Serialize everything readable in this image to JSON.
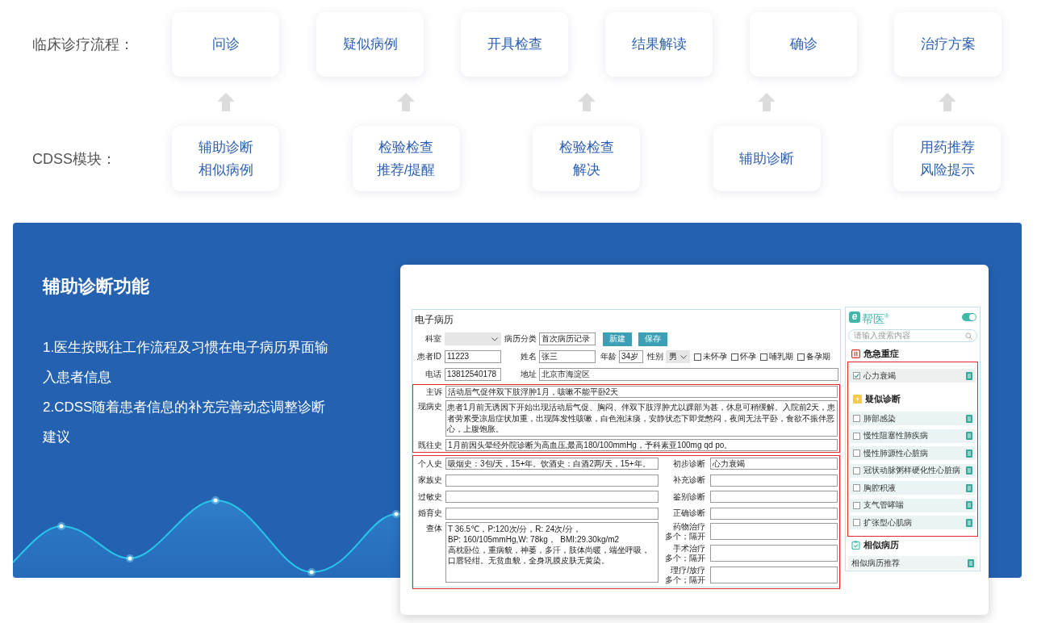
{
  "flow": {
    "label": "临床诊疗流程：",
    "steps": [
      "问诊",
      "疑似病例",
      "开具检查",
      "结果解读",
      "确诊",
      "治疗方案"
    ]
  },
  "cdss": {
    "label": "CDSS模块：",
    "modules": [
      "辅助诊断相似病例",
      "检验检查推荐/提醒",
      "检验检查解决",
      "辅助诊断",
      "用药推荐风险提示"
    ]
  },
  "feature": {
    "title": "辅助诊断功能",
    "points": [
      "1.医生按既往工作流程及习惯在电子病历界面输入患者信息",
      "2.CDSS随着患者信息的补充完善动态调整诊断建议"
    ]
  },
  "emr": {
    "title": "电子病历",
    "department": {
      "label": "科室"
    },
    "record_type": {
      "label": "病历分类",
      "value": "首次病历记录"
    },
    "buttons": [
      "新建",
      "保存"
    ],
    "patient_id": {
      "label": "患者ID",
      "value": "11223"
    },
    "name": {
      "label": "姓名",
      "value": "张三"
    },
    "age": {
      "label": "年龄",
      "value": "34岁"
    },
    "sex": {
      "label": "性别",
      "value": "男"
    },
    "pregnancy": [
      {
        "label": "未怀孕",
        "checked": false
      },
      {
        "label": "怀孕",
        "checked": false
      },
      {
        "label": "哺乳期",
        "checked": false
      },
      {
        "label": "备孕期",
        "checked": false
      }
    ],
    "phone": {
      "label": "电话",
      "value": "13812540178"
    },
    "address": {
      "label": "地址",
      "value": "北京市海淀区"
    },
    "history": [
      {
        "kind": "line",
        "label": "主诉",
        "value": "活动后气促伴双下肢浮肿1月，咳嗽不能平卧2天"
      },
      {
        "kind": "area",
        "label": "现病史",
        "value": "患者1月前无诱因下开始出现活动后气促、胸闷、伴双下肢浮肿尤以踝部为甚，休息可稍缓解。入院前2天，患者劳累受凉后症状加重，出现阵发性咳嗽，白色泡沫痰，安静状态下即觉憋闷，夜间无法平卧，食欲不振伴恶心，上腹饱胀。"
      },
      {
        "kind": "line",
        "label": "既往史",
        "value": "1月前因头晕经外院诊断为高血压,最高180/100mmHg，予科素亚100mg qd po。"
      }
    ],
    "details_left": [
      {
        "kind": "line",
        "label": "个人史",
        "value": "吸烟史：3包/天，15+年。饮酒史：白酒2两/天，15+年。"
      },
      {
        "kind": "line",
        "label": "家族史"
      },
      {
        "kind": "line",
        "label": "过敏史"
      },
      {
        "kind": "line",
        "label": "婚育史"
      },
      {
        "kind": "area",
        "label": "查体",
        "lines": [
          "T 36.5℃，P:120次/分，R: 24次/分，",
          "BP: 160/105mmHg,W: 78kg，  BMI:29.30kg/m2",
          "高枕卧位，重病貌，神萎，多汗，肢体尚暖，端坐呼吸，",
          "口唇轻绀。无贫血貌，全身巩膜皮肤无黄染。"
        ]
      }
    ],
    "details_right": [
      {
        "kind": "line",
        "label": "初步诊断",
        "value": "心力衰竭"
      },
      {
        "kind": "line",
        "label": "补充诊断"
      },
      {
        "kind": "line",
        "label": "鉴别诊断"
      },
      {
        "kind": "line",
        "label": "正确诊断"
      },
      {
        "kind": "tall",
        "label": "药物治疗",
        "hint": "多个；隔开"
      },
      {
        "kind": "tall",
        "label": "手术治疗",
        "hint": "多个；隔开"
      },
      {
        "kind": "tall",
        "label": "理疗/放疗",
        "hint": "多个；隔开"
      }
    ]
  },
  "sidebar": {
    "logo": {
      "mark": "e",
      "name": "帮医$^{®}$"
    },
    "switch_on": true,
    "search": {
      "placeholder": "请输入搜索内容"
    },
    "critical": {
      "title": "危急重症",
      "items": [
        {
          "label": "心力衰竭",
          "checked": true
        }
      ]
    },
    "suspected": {
      "title": "疑似诊断",
      "items": [
        {
          "label": "肺部感染",
          "checked": false
        },
        {
          "label": "慢性阻塞性肺疾病",
          "checked": false
        },
        {
          "label": "慢性肺源性心脏病",
          "checked": false
        },
        {
          "label": "冠状动脉粥样硬化性心脏病",
          "checked": false
        },
        {
          "label": "胸腔积液",
          "checked": false
        },
        {
          "label": "支气管哮喘",
          "checked": false
        },
        {
          "label": "扩张型心肌病",
          "checked": false
        }
      ]
    },
    "similar": {
      "title": "相似病历",
      "items": [
        {
          "label": "相似病历推荐"
        }
      ]
    }
  }
}
